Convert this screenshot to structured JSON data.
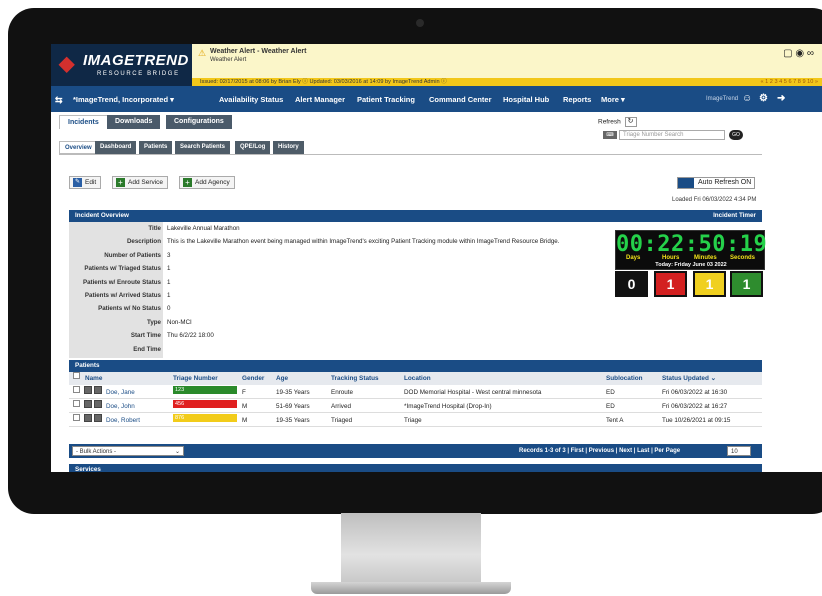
{
  "logo": {
    "brand": "IMAGETREND",
    "sub": "RESOURCE BRIDGE"
  },
  "alert": {
    "title": "Weather Alert - Weather Alert",
    "subtitle": "Weather Alert",
    "issued": "Issued: 02/17/2015 at 08:06 by Brian Ely ⓘ    Updated: 03/03/2016 at 14:09 by ImageTrend Admin ⓘ",
    "pages": "« 1 2 3 4 5 6 7 8 9 10 »"
  },
  "nav": {
    "org": "*ImageTrend, Incorporated",
    "items": [
      "Availability Status",
      "Alert Manager",
      "Patient Tracking",
      "Command Center",
      "Hospital Hub",
      "Reports",
      "More"
    ],
    "user": "ImageTrend"
  },
  "top_tabs": [
    "Incidents",
    "Downloads",
    "Configurations"
  ],
  "refresh_label": "Refresh",
  "triage_placeholder": "Triage Number Search",
  "go_label": "GO",
  "sub_tabs": [
    "Overview",
    "Dashboard",
    "Patients",
    "Search Patients",
    "QPE/Log",
    "History"
  ],
  "actions": {
    "edit": "Edit",
    "add_service": "Add Service",
    "add_agency": "Add Agency",
    "auto_refresh": "Auto Refresh ON"
  },
  "loaded": "Loaded Fri 06/03/2022 4:34 PM",
  "overview": {
    "header": "Incident Overview",
    "timer_header": "Incident Timer",
    "rows": [
      {
        "label": "Title",
        "value": "Lakeville Annual Marathon"
      },
      {
        "label": "Description",
        "value": "This is the Lakeville Marathon event being managed within ImageTrend's exciting Patient Tracking module within ImageTrend Resource Bridge."
      },
      {
        "label": "Number of Patients",
        "value": "3"
      },
      {
        "label": "Patients w/ Triaged Status",
        "value": "1"
      },
      {
        "label": "Patients w/ Enroute Status",
        "value": "1"
      },
      {
        "label": "Patients w/ Arrived Status",
        "value": "1"
      },
      {
        "label": "Patients w/ No Status",
        "value": "0"
      },
      {
        "label": "Type",
        "value": "Non-MCI"
      },
      {
        "label": "Start Time",
        "value": "Thu 6/2/22 18:00"
      },
      {
        "label": "End Time",
        "value": ""
      }
    ]
  },
  "timer": {
    "display": "00:22:50:19",
    "units": [
      "Days",
      "Hours",
      "Minutes",
      "Seconds"
    ],
    "today": "Today: Friday June 03 2022",
    "counts": [
      {
        "value": "0",
        "color": "#111111"
      },
      {
        "value": "1",
        "color": "#d32020"
      },
      {
        "value": "1",
        "color": "#f0d020"
      },
      {
        "value": "1",
        "color": "#2e8c2e"
      }
    ]
  },
  "patients": {
    "header": "Patients",
    "columns": [
      "Name",
      "Triage Number",
      "Gender",
      "Age",
      "Tracking Status",
      "Location",
      "Sublocation",
      "Status Updated ⌄"
    ],
    "rows": [
      {
        "name": "Doe, Jane",
        "triage": "123",
        "triage_color": "#2a8a2a",
        "gender": "F",
        "age": "19-35 Years",
        "status": "Enroute",
        "location": "DOD Memorial Hospital - West central minnesota",
        "sublocation": "ED",
        "updated": "Fri 06/03/2022 at 16:30"
      },
      {
        "name": "Doe, John",
        "triage": "456",
        "triage_color": "#e02020",
        "gender": "M",
        "age": "51-69 Years",
        "status": "Arrived",
        "location": "*ImageTrend Hospital (Drop-In)",
        "sublocation": "ED",
        "updated": "Fri 06/03/2022 at 16:27"
      },
      {
        "name": "Doe, Robert",
        "triage": "876",
        "triage_color": "#f2cc1a",
        "gender": "M",
        "age": "19-35 Years",
        "status": "Triaged",
        "location": "Triage",
        "sublocation": "Tent A",
        "updated": "Tue 10/26/2021 at 09:15"
      }
    ]
  },
  "pager": {
    "bulk": "- Bulk Actions -",
    "records": "Records 1-3 of 3  |  First  |  Previous  |  Next  |  Last  |  Per Page",
    "per_page": "10"
  },
  "services_header": "Services"
}
